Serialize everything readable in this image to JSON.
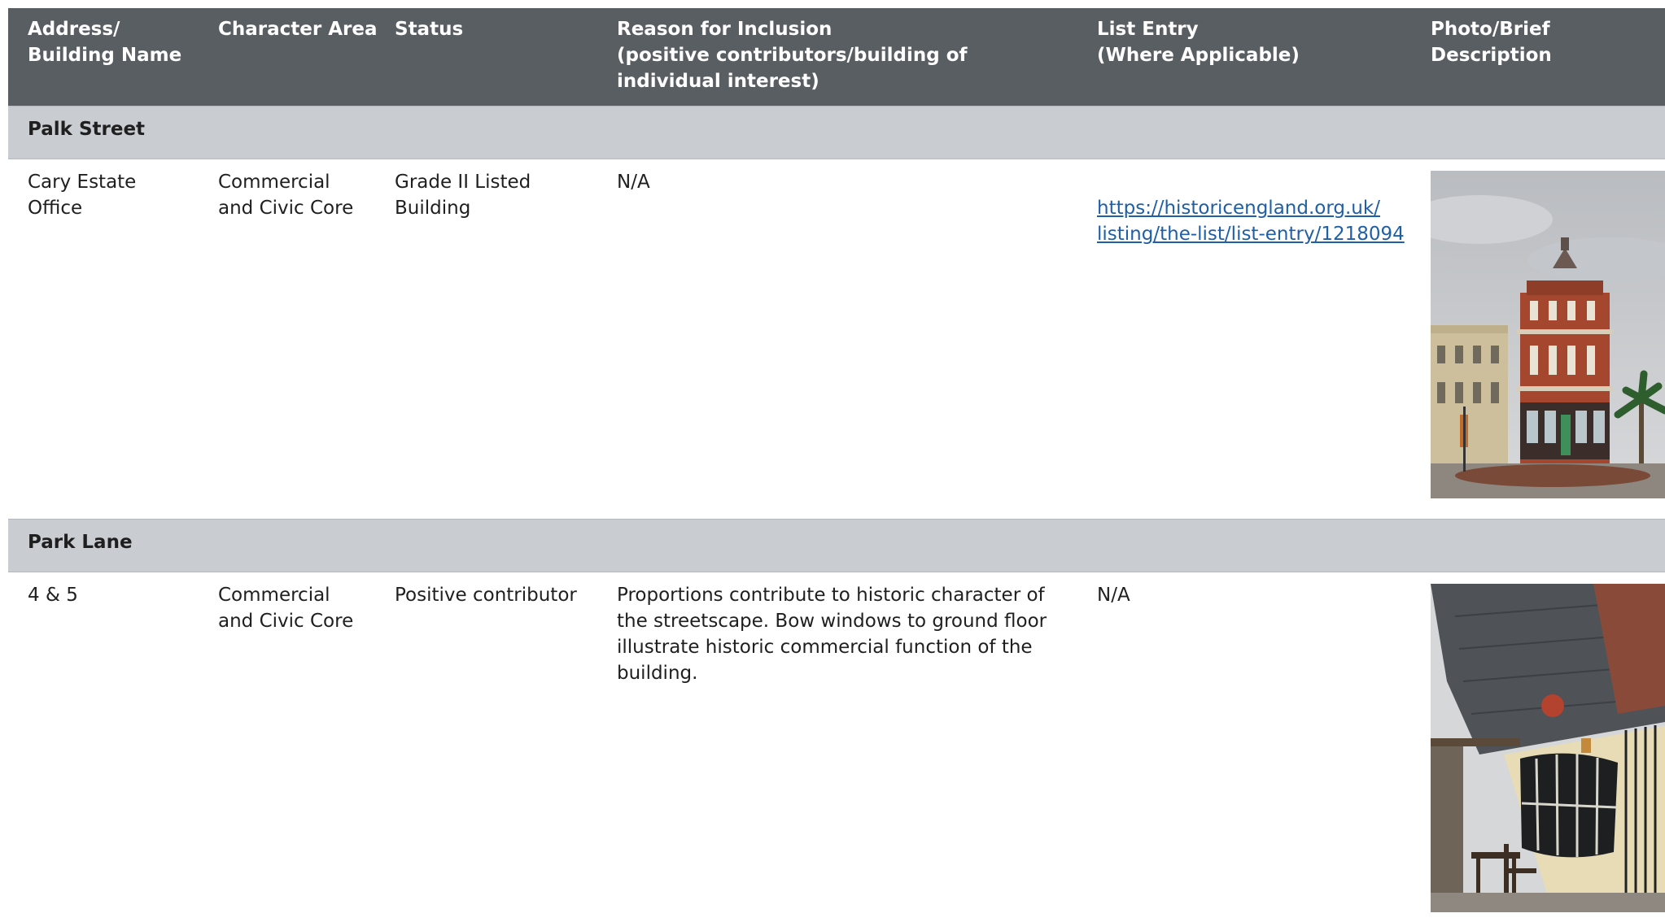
{
  "table": {
    "headers": [
      "Address/\nBuilding Name",
      "Character Area",
      "Status",
      "Reason for Inclusion\n(positive contributors/building of individual interest)",
      "List Entry\n(Where Applicable)",
      "Photo/Brief Description"
    ],
    "sections": [
      {
        "title": "Palk Street",
        "row": {
          "address": "Cary Estate\nOffice",
          "character_area": "Commercial\nand Civic Core",
          "status": "Grade II Listed\nBuilding",
          "reason": "N/A",
          "list_entry": "https://historicengland.org.uk/\nlisting/the-list/list-entry/1218094",
          "photo_icon": "photo-red-brick-octagonal-building"
        }
      },
      {
        "title": "Park Lane",
        "row": {
          "address": "4 & 5",
          "character_area": "Commercial\nand Civic Core",
          "status": "Positive contributor",
          "reason": "Proportions contribute to historic character of the streetscape. Bow windows to ground floor illustrate historic commercial function of the building.",
          "list_entry": "N/A",
          "photo_icon": "photo-bow-window-building"
        }
      }
    ]
  },
  "colors": {
    "header_bg": "#595e63",
    "section_bg": "#c9ccd0",
    "link": "#1f5fa6"
  }
}
